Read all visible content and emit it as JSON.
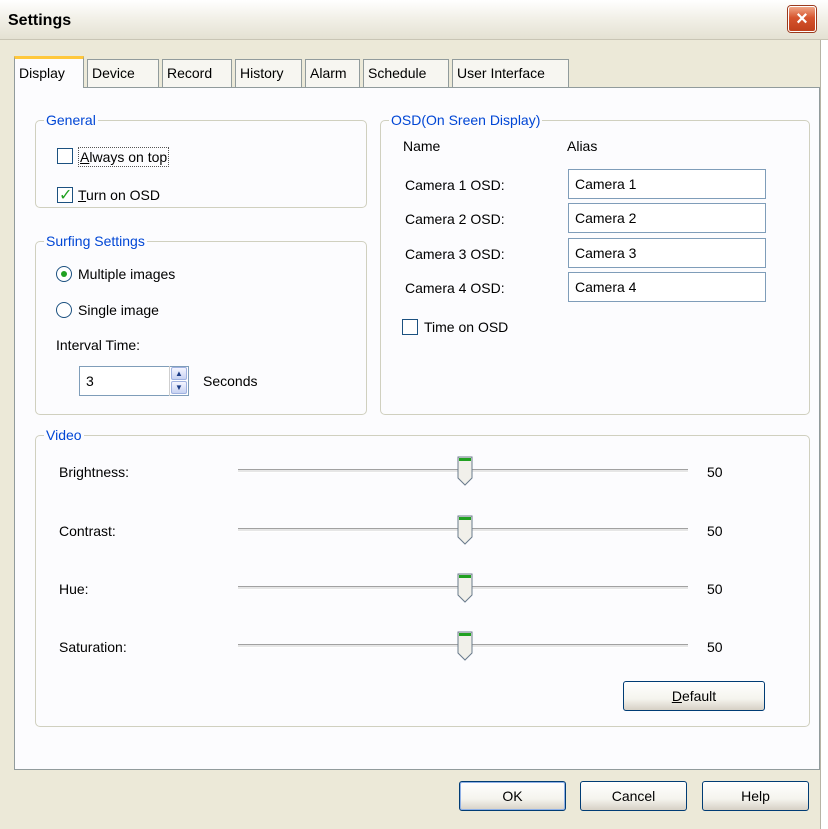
{
  "window": {
    "title": "Settings",
    "close_glyph": "×"
  },
  "tabs": [
    {
      "label": "Display",
      "active": true
    },
    {
      "label": "Device"
    },
    {
      "label": "Record"
    },
    {
      "label": "History"
    },
    {
      "label": "Alarm"
    },
    {
      "label": "Schedule"
    },
    {
      "label": "User Interface"
    }
  ],
  "general": {
    "legend": "General",
    "always_on_top": {
      "prefix": "A",
      "rest": "lways on top",
      "checked": false
    },
    "turn_on_osd": {
      "prefix": "T",
      "rest": "urn on OSD",
      "checked": true
    }
  },
  "surfing": {
    "legend": "Surfing Settings",
    "multiple_images": {
      "label": "Multiple images",
      "selected": true
    },
    "single_image": {
      "label": "Single image",
      "selected": false
    },
    "interval_label": "Interval Time:",
    "interval_value": "3",
    "seconds_label": "Seconds"
  },
  "osd": {
    "legend": "OSD(On Sreen Display)",
    "name_header": "Name",
    "alias_header": "Alias",
    "rows": [
      {
        "label": "Camera 1 OSD:",
        "alias": "Camera 1"
      },
      {
        "label": "Camera 2 OSD:",
        "alias": "Camera 2"
      },
      {
        "label": "Camera 3 OSD:",
        "alias": "Camera 3"
      },
      {
        "label": "Camera 4 OSD:",
        "alias": "Camera 4"
      }
    ],
    "time_on_osd": {
      "label": "Time on OSD",
      "checked": false
    }
  },
  "video": {
    "legend": "Video",
    "sliders": [
      {
        "label": "Brightness:",
        "value": "50"
      },
      {
        "label": "Contrast:",
        "value": "50"
      },
      {
        "label": "Hue:",
        "value": "50"
      },
      {
        "label": "Saturation:",
        "value": "50"
      }
    ],
    "default_button": {
      "prefix": "D",
      "rest": "efault"
    }
  },
  "footer": {
    "ok": "OK",
    "cancel": "Cancel",
    "help": "Help"
  },
  "colors": {
    "legend_text": "#0046d5",
    "check_mark": "#21a121",
    "tab_highlight": "#ffc83c",
    "close_button": "#d6542e"
  }
}
